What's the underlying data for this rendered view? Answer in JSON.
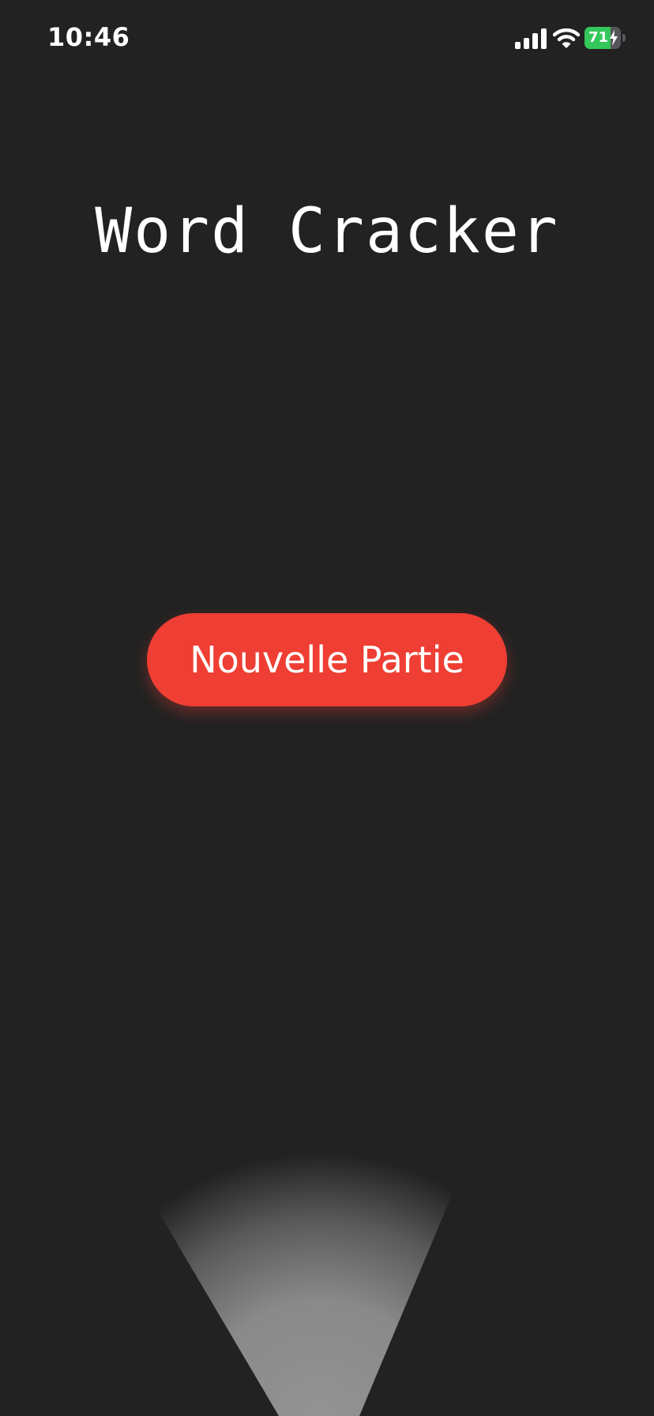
{
  "status_bar": {
    "time": "10:46",
    "battery_level_text": "71",
    "battery_level_fraction": 0.71,
    "signal_icon": "cellular-signal-icon",
    "wifi_icon": "wifi-icon",
    "charging_icon": "charging-bolt-icon",
    "battery_color": "#34c759"
  },
  "main": {
    "title": "Word Cracker",
    "new_game_label": "Nouvelle Partie",
    "accent_color": "#ef3e33",
    "background_color": "#222222"
  }
}
